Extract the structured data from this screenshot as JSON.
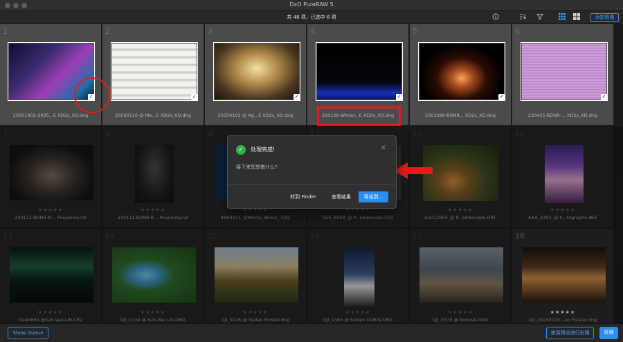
{
  "window": {
    "title": "DxO PureRAW 5"
  },
  "toolbar": {
    "count": "共 48 项，已选中 6 项",
    "add_button": "添加图像"
  },
  "icons": {
    "info": "info-icon",
    "sort": "sort-icon",
    "filter": "filter-icon",
    "grid_view": "grid-view-icon",
    "compare_view": "compare-view-icon"
  },
  "colors": {
    "accent": "#2d8cf0",
    "annotation": "#e31b1b",
    "success": "#2fb24a"
  },
  "cells": [
    {
      "num": "1",
      "file": "20251902-2035...E XD2s_XD.dng",
      "selected": true,
      "stars": 0
    },
    {
      "num": "2",
      "file": "20260110 @ Ma...E XD2s_XD.dng",
      "selected": true,
      "stars": 0
    },
    {
      "num": "3",
      "file": "20350103 @ Ag...E XD2s_XD.dng",
      "selected": true,
      "stars": 0
    },
    {
      "num": "4",
      "file": "220126-Winter...E XD2s_XD.dng",
      "selected": true,
      "stars": 0
    },
    {
      "num": "5",
      "file": "2303289-BONR... XD2s_XD.dng",
      "selected": true,
      "stars": 0
    },
    {
      "num": "6",
      "file": "230425-BONR-... XD2s_XD.dng",
      "selected": true,
      "stars": 0
    },
    {
      "num": "7",
      "file": "240112-BONR-M... Poupeney.raf",
      "selected": false,
      "stars": 0
    },
    {
      "num": "8",
      "file": "240112-BONR-R... Poupeney.raf",
      "selected": false,
      "stars": 0
    },
    {
      "num": "9",
      "file": "44A9411_@Wanja_Wiese_.CR2",
      "selected": false,
      "stars": 0
    },
    {
      "num": "10",
      "file": "5DS_8069_@ P...ambousek.CR2",
      "selected": false,
      "stars": 0
    },
    {
      "num": "11",
      "file": "A1012854_@ P...ambousek.ORF",
      "selected": false,
      "stars": 0
    },
    {
      "num": "12",
      "file": "AAA_3392_@ A...tographe.NEF",
      "selected": false,
      "stars": 0
    },
    {
      "num": "13",
      "file": "D2A6860 @Kah-Wai-LIN.CR2",
      "selected": false,
      "stars": 0
    },
    {
      "num": "14",
      "file": "DJI_0134 @ Kah-Wai Lin.DNG",
      "selected": false,
      "stars": 0
    },
    {
      "num": "15",
      "file": "DJI_0276 @ Stefan Forster.dng",
      "selected": false,
      "stars": 0
    },
    {
      "num": "16",
      "file": "DJI_0363 @ Fabien DUBIN.DNG",
      "selected": false,
      "stars": 0
    },
    {
      "num": "17",
      "file": "DJI_0378 @ Nobosk.DNG",
      "selected": false,
      "stars": 0
    },
    {
      "num": "18",
      "file": "DJI_20230720...an Forster.dng",
      "selected": false,
      "stars": 5
    }
  ],
  "dialog": {
    "title": "处理完成!",
    "subtitle": "接下来您想做什么?",
    "finder": "转到 Finder",
    "view": "查看结果",
    "export": "导出到..."
  },
  "bottom": {
    "show_queue": "Show Queue",
    "preset": "使用预设进行处理",
    "process": "处理"
  }
}
